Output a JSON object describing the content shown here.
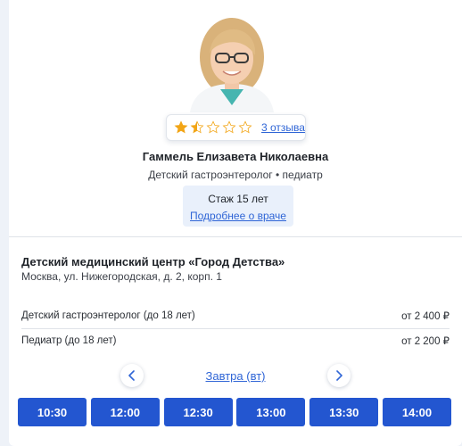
{
  "doctor": {
    "name": "Гаммель Елизавета Николаевна",
    "specialty": "Детский гастроэнтеролог • педиатр",
    "rating_stars": 1.5,
    "rating_max": 5,
    "reviews_link": "3 отзыва",
    "experience": "Стаж 15 лет",
    "more_link": "Подробнее о враче"
  },
  "clinic": {
    "name": "Детский медицинский центр «Город Детства»",
    "address": "Москва, ул. Нижегородская, д. 2, корп. 1"
  },
  "services": [
    {
      "name": "Детский гастроэнтеролог (до 18 лет)",
      "price": "от 2 400 ₽"
    },
    {
      "name": "Педиатр (до 18 лет)",
      "price": "от 2 200 ₽"
    }
  ],
  "schedule": {
    "prev_icon": "chevron-left-icon",
    "next_icon": "chevron-right-icon",
    "date_label": "Завтра (вт)",
    "slots": [
      "10:30",
      "12:00",
      "12:30",
      "13:00",
      "13:30",
      "14:00"
    ]
  },
  "colors": {
    "accent": "#2356d0",
    "link": "#2f65d6",
    "star": "#f2a516",
    "experience_bg": "#e9f0fb"
  }
}
